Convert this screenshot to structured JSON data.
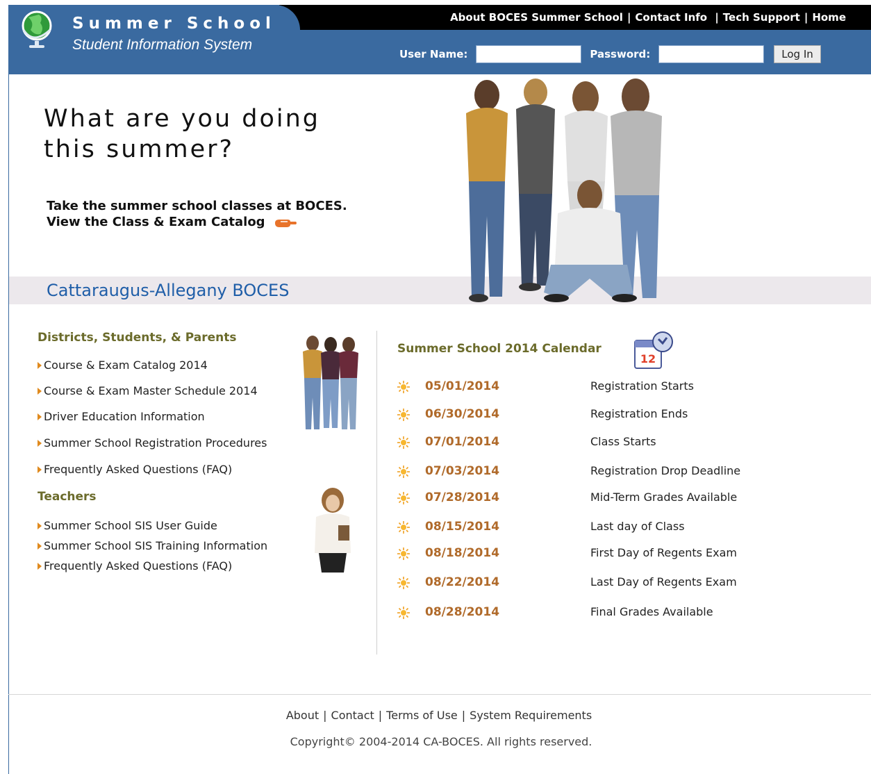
{
  "header": {
    "brand_title": "Summer School",
    "brand_subtitle": "Student Information System",
    "top_links": [
      "About BOCES Summer School",
      "Contact Info",
      "Tech Support",
      "Home"
    ],
    "login": {
      "username_label": "User Name:",
      "password_label": "Password:",
      "username_value": "",
      "password_value": "",
      "login_button": "Log In"
    }
  },
  "hero": {
    "headline": "What are you doing this summer?",
    "line1": "Take the summer school classes at BOCES.",
    "line2": "View the Class & Exam Catalog",
    "band_title": "Cattaraugus-Allegany BOCES"
  },
  "left": {
    "section1_title": "Districts, Students, & Parents",
    "section1_links": [
      "Course & Exam Catalog 2014",
      "Course & Exam Master Schedule 2014",
      "Driver Education Information",
      "Summer School Registration Procedures",
      "Frequently Asked Questions (FAQ)"
    ],
    "section2_title": "Teachers",
    "section2_links": [
      "Summer School SIS User Guide",
      "Summer School SIS Training Information",
      "Frequently Asked Questions (FAQ)"
    ]
  },
  "calendar": {
    "title": "Summer School 2014 Calendar",
    "icon_label": "12",
    "entries": [
      {
        "date": "05/01/2014",
        "event": "Registration Starts"
      },
      {
        "date": "06/30/2014",
        "event": "Registration Ends"
      },
      {
        "date": "07/01/2014",
        "event": "Class Starts"
      },
      {
        "date": "07/03/2014",
        "event": "Registration Drop Deadline"
      },
      {
        "date": "07/28/2014",
        "event": "Mid-Term Grades Available"
      },
      {
        "date": "08/15/2014",
        "event": "Last day of Class"
      },
      {
        "date": "08/18/2014",
        "event": "First Day of Regents Exam"
      },
      {
        "date": "08/22/2014",
        "event": "Last Day of Regents Exam"
      },
      {
        "date": "08/28/2014",
        "event": "Final Grades Available"
      }
    ]
  },
  "footer": {
    "links": [
      "About",
      "Contact",
      "Terms of Use",
      "System Requirements"
    ],
    "copyright": "Copyright© 2004-2014 CA-BOCES. All rights reserved."
  },
  "colors": {
    "header_blue": "#3a6aa0",
    "band_title": "#1f5ea8",
    "section_heading": "#6b6b2b",
    "date_text": "#b06a2a",
    "bullet_orange": "#e08a1e"
  },
  "icons": [
    "globe-icon",
    "pointing-hand-icon",
    "calendar-clock-icon",
    "sun-icon",
    "triangle-bullet-icon"
  ]
}
